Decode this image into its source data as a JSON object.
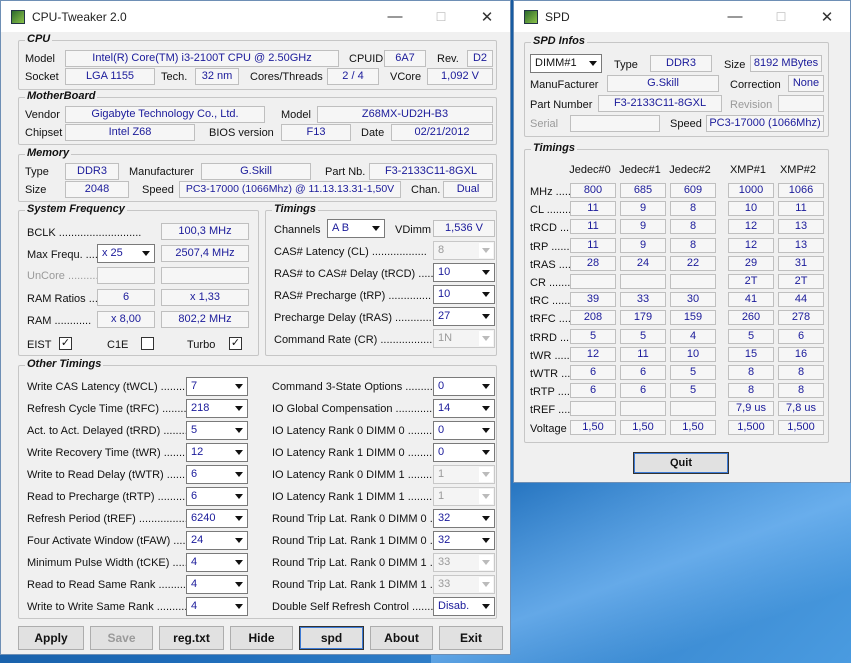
{
  "main": {
    "title": "CPU-Tweaker 2.0",
    "cpu": {
      "title": "CPU",
      "model_label": "Model",
      "model": "Intel(R) Core(TM) i3-2100T CPU @ 2.50GHz",
      "cpuid_label": "CPUID",
      "cpuid": "6A7",
      "rev_label": "Rev.",
      "rev": "D2",
      "socket_label": "Socket",
      "socket": "LGA 1155",
      "tech_label": "Tech.",
      "tech": "32 nm",
      "cores_label": "Cores/Threads",
      "cores": "2 / 4",
      "vcore_label": "VCore",
      "vcore": "1,092 V"
    },
    "mb": {
      "title": "MotherBoard",
      "vendor_label": "Vendor",
      "vendor": "Gigabyte Technology Co., Ltd.",
      "model_label": "Model",
      "model": "Z68MX-UD2H-B3",
      "chipset_label": "Chipset",
      "chipset": "Intel Z68",
      "bios_label": "BIOS version",
      "bios": "F13",
      "date_label": "Date",
      "date": "02/21/2012"
    },
    "mem": {
      "title": "Memory",
      "type_label": "Type",
      "type": "DDR3",
      "manuf_label": "Manufacturer",
      "manuf": "G.Skill",
      "partnb_label": "Part Nb.",
      "partnb": "F3-2133C11-8GXL",
      "size_label": "Size",
      "size": "2048",
      "speed_label": "Speed",
      "speed": "PC3-17000 (1066Mhz) @ 11.13.13.31-1,50V",
      "chan_label": "Chan.",
      "chan": "Dual"
    },
    "sysfreq": {
      "title": "System Frequency",
      "bclk_label": "BCLK ...........................",
      "bclk": "100,3 MHz",
      "maxfreq_label": "Max Frequ. ......",
      "mult": "x 25",
      "maxfreq": "2507,4 MHz",
      "uncore_label": "UnCore ..................",
      "ramratio_label": "RAM Ratios ......",
      "ramratio": "6",
      "ramratio_mult": "x 1,33",
      "ram_label": "RAM ............",
      "ram_mult": "x 8,00",
      "ram": "802,2 MHz",
      "eist_label": "EIST",
      "eist": "✓",
      "c1e_label": "C1E",
      "c1e": "",
      "turbo_label": "Turbo",
      "turbo": "✓"
    },
    "timings": {
      "title": "Timings",
      "channels_label": "Channels",
      "channels": "A  B",
      "vdimm_label": "VDimm",
      "vdimm": "1,536 V",
      "items": [
        {
          "label": "CAS# Latency (CL) ..................",
          "value": "8"
        },
        {
          "label": "RAS# to CAS# Delay (tRCD) ......",
          "value": "10"
        },
        {
          "label": "RAS# Precharge (tRP) ..............",
          "value": "10"
        },
        {
          "label": "Precharge Delay (tRAS) .............",
          "value": "27"
        },
        {
          "label": "Command Rate (CR) ..................",
          "value": "1N"
        }
      ]
    },
    "other": {
      "title": "Other Timings",
      "left": [
        {
          "label": "Write CAS Latency (tWCL) ..........",
          "value": "7"
        },
        {
          "label": "Refresh Cycle Time (tRFC) .........",
          "value": "218"
        },
        {
          "label": "Act. to Act. Delayed (tRRD) ........",
          "value": "5"
        },
        {
          "label": "Write Recovery Time (tWR) .........",
          "value": "12"
        },
        {
          "label": "Write to Read Delay (tWTR) ........",
          "value": "6"
        },
        {
          "label": "Read to Precharge (tRTP) ...........",
          "value": "6"
        },
        {
          "label": "Refresh Period (tREF) ..................",
          "value": "6240"
        },
        {
          "label": "Four Activate Window (tFAW) .....",
          "value": "24"
        },
        {
          "label": "Minimum Pulse Width (tCKE) ......",
          "value": "4"
        },
        {
          "label": "Read to Read Same Rank ............",
          "value": "4"
        },
        {
          "label": "Write to Write Same Rank ............",
          "value": "4"
        }
      ],
      "right": [
        {
          "label": "Command 3-State Options ..........",
          "value": "0"
        },
        {
          "label": "IO Global Compensation ..............",
          "value": "14"
        },
        {
          "label": "IO Latency Rank 0 DIMM 0 ..........",
          "value": "0"
        },
        {
          "label": "IO Latency Rank 1 DIMM 0 ..........",
          "value": "0"
        },
        {
          "label": "IO Latency Rank 0 DIMM 1 ..........",
          "value": "1"
        },
        {
          "label": "IO Latency Rank 1 DIMM 1 ..........",
          "value": "1"
        },
        {
          "label": "Round Trip Lat. Rank 0 DIMM 0 ....",
          "value": "32"
        },
        {
          "label": "Round Trip Lat. Rank 1 DIMM 0 ....",
          "value": "32"
        },
        {
          "label": "Round Trip Lat. Rank 0 DIMM 1 ....",
          "value": "33"
        },
        {
          "label": "Round Trip Lat. Rank 1 DIMM 1 ....",
          "value": "33"
        },
        {
          "label": "Double Self Refresh Control .......",
          "value": "Disab."
        }
      ]
    },
    "buttons": {
      "apply": "Apply",
      "save": "Save",
      "regtxt": "reg.txt",
      "hide": "Hide",
      "spd": "spd",
      "about": "About",
      "exit": "Exit"
    }
  },
  "spd": {
    "title": "SPD",
    "infos": {
      "title": "SPD Infos",
      "dimm": "DIMM#1",
      "type_label": "Type",
      "type": "DDR3",
      "size_label": "Size",
      "size": "8192 MBytes",
      "manuf_label": "ManuFacturer",
      "manuf": "G.Skill",
      "corr_label": "Correction",
      "corr": "None",
      "partnum_label": "Part Number",
      "partnum": "F3-2133C11-8GXL",
      "revision_label": "Revision",
      "revision": "",
      "serial_label": "Serial",
      "serial": "",
      "speed_label": "Speed",
      "speed": "PC3-17000 (1066Mhz)"
    },
    "timings": {
      "title": "Timings",
      "headers": [
        "Jedec#0",
        "Jedec#1",
        "Jedec#2",
        "XMP#1",
        "XMP#2"
      ],
      "rows": [
        {
          "label": "MHz .....",
          "values": [
            "800",
            "685",
            "609",
            "1000",
            "1066"
          ]
        },
        {
          "label": "CL .........",
          "values": [
            "11",
            "9",
            "8",
            "10",
            "11"
          ]
        },
        {
          "label": "tRCD .....",
          "values": [
            "11",
            "9",
            "8",
            "12",
            "13"
          ]
        },
        {
          "label": "tRP .......",
          "values": [
            "11",
            "9",
            "8",
            "12",
            "13"
          ]
        },
        {
          "label": "tRAS .....",
          "values": [
            "28",
            "24",
            "22",
            "29",
            "31"
          ]
        },
        {
          "label": "CR .........",
          "values": [
            "",
            "",
            "",
            "2T",
            "2T"
          ]
        },
        {
          "label": "tRC .......",
          "values": [
            "39",
            "33",
            "30",
            "41",
            "44"
          ]
        },
        {
          "label": "tRFC .....",
          "values": [
            "208",
            "179",
            "159",
            "260",
            "278"
          ]
        },
        {
          "label": "tRRD .....",
          "values": [
            "5",
            "5",
            "4",
            "5",
            "6"
          ]
        },
        {
          "label": "tWR .......",
          "values": [
            "12",
            "11",
            "10",
            "15",
            "16"
          ]
        },
        {
          "label": "tWTR .....",
          "values": [
            "6",
            "6",
            "5",
            "8",
            "8"
          ]
        },
        {
          "label": "tRTP .....",
          "values": [
            "6",
            "6",
            "5",
            "8",
            "8"
          ]
        },
        {
          "label": "tREF .....",
          "values": [
            "",
            "",
            "",
            "7,9 us",
            "7,8 us"
          ]
        },
        {
          "label": "Voltage",
          "values": [
            "1,50",
            "1,50",
            "1,50",
            "1,500",
            "1,500"
          ]
        }
      ]
    },
    "quit": "Quit"
  }
}
